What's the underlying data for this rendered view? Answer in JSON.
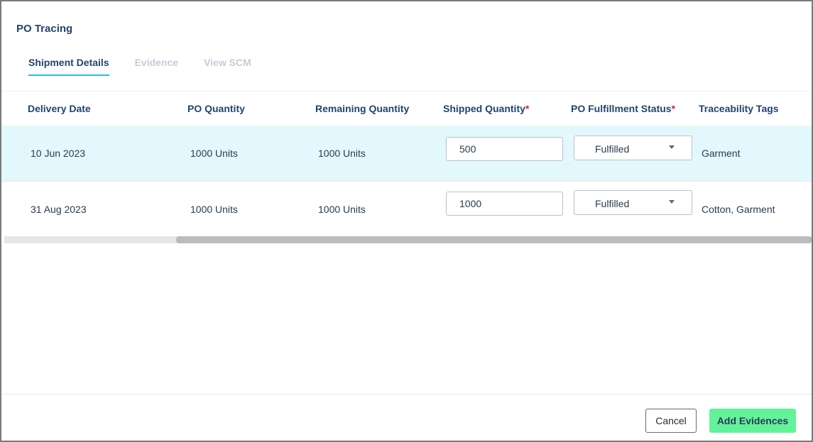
{
  "modal": {
    "title": "PO Tracing",
    "tabs": [
      {
        "label": "Shipment Details",
        "active": true
      },
      {
        "label": "Evidence",
        "active": false
      },
      {
        "label": "View SCM",
        "active": false
      }
    ]
  },
  "table": {
    "headers": {
      "delivery_date": "Delivery Date",
      "po_quantity": "PO Quantity",
      "remaining_quantity": "Remaining Quantity",
      "shipped_quantity": "Shipped Quantity",
      "fulfillment_status": "PO Fulfillment Status",
      "traceability_tags": "Traceability Tags",
      "required_marker": "*"
    },
    "rows": [
      {
        "delivery_date": "10 Jun 2023",
        "po_quantity": "1000 Units",
        "remaining_quantity": "1000 Units",
        "shipped_quantity": "500",
        "fulfillment_status": "Fulfilled",
        "traceability_tags": "Garment",
        "highlighted": true
      },
      {
        "delivery_date": "31 Aug 2023",
        "po_quantity": "1000 Units",
        "remaining_quantity": "1000 Units",
        "shipped_quantity": "1000",
        "fulfillment_status": "Fulfilled",
        "traceability_tags": "Cotton, Garment",
        "highlighted": false
      }
    ]
  },
  "footer": {
    "cancel_label": "Cancel",
    "add_evidences_label": "Add Evidences"
  },
  "colors": {
    "accent_tab_underline": "#2cb7e8",
    "highlight_row": "#e3f8fc",
    "primary_button": "#63f29a",
    "required": "#e0212e",
    "heading_text": "#24436b"
  },
  "icons": {
    "dropdown": "caret-down-icon"
  }
}
